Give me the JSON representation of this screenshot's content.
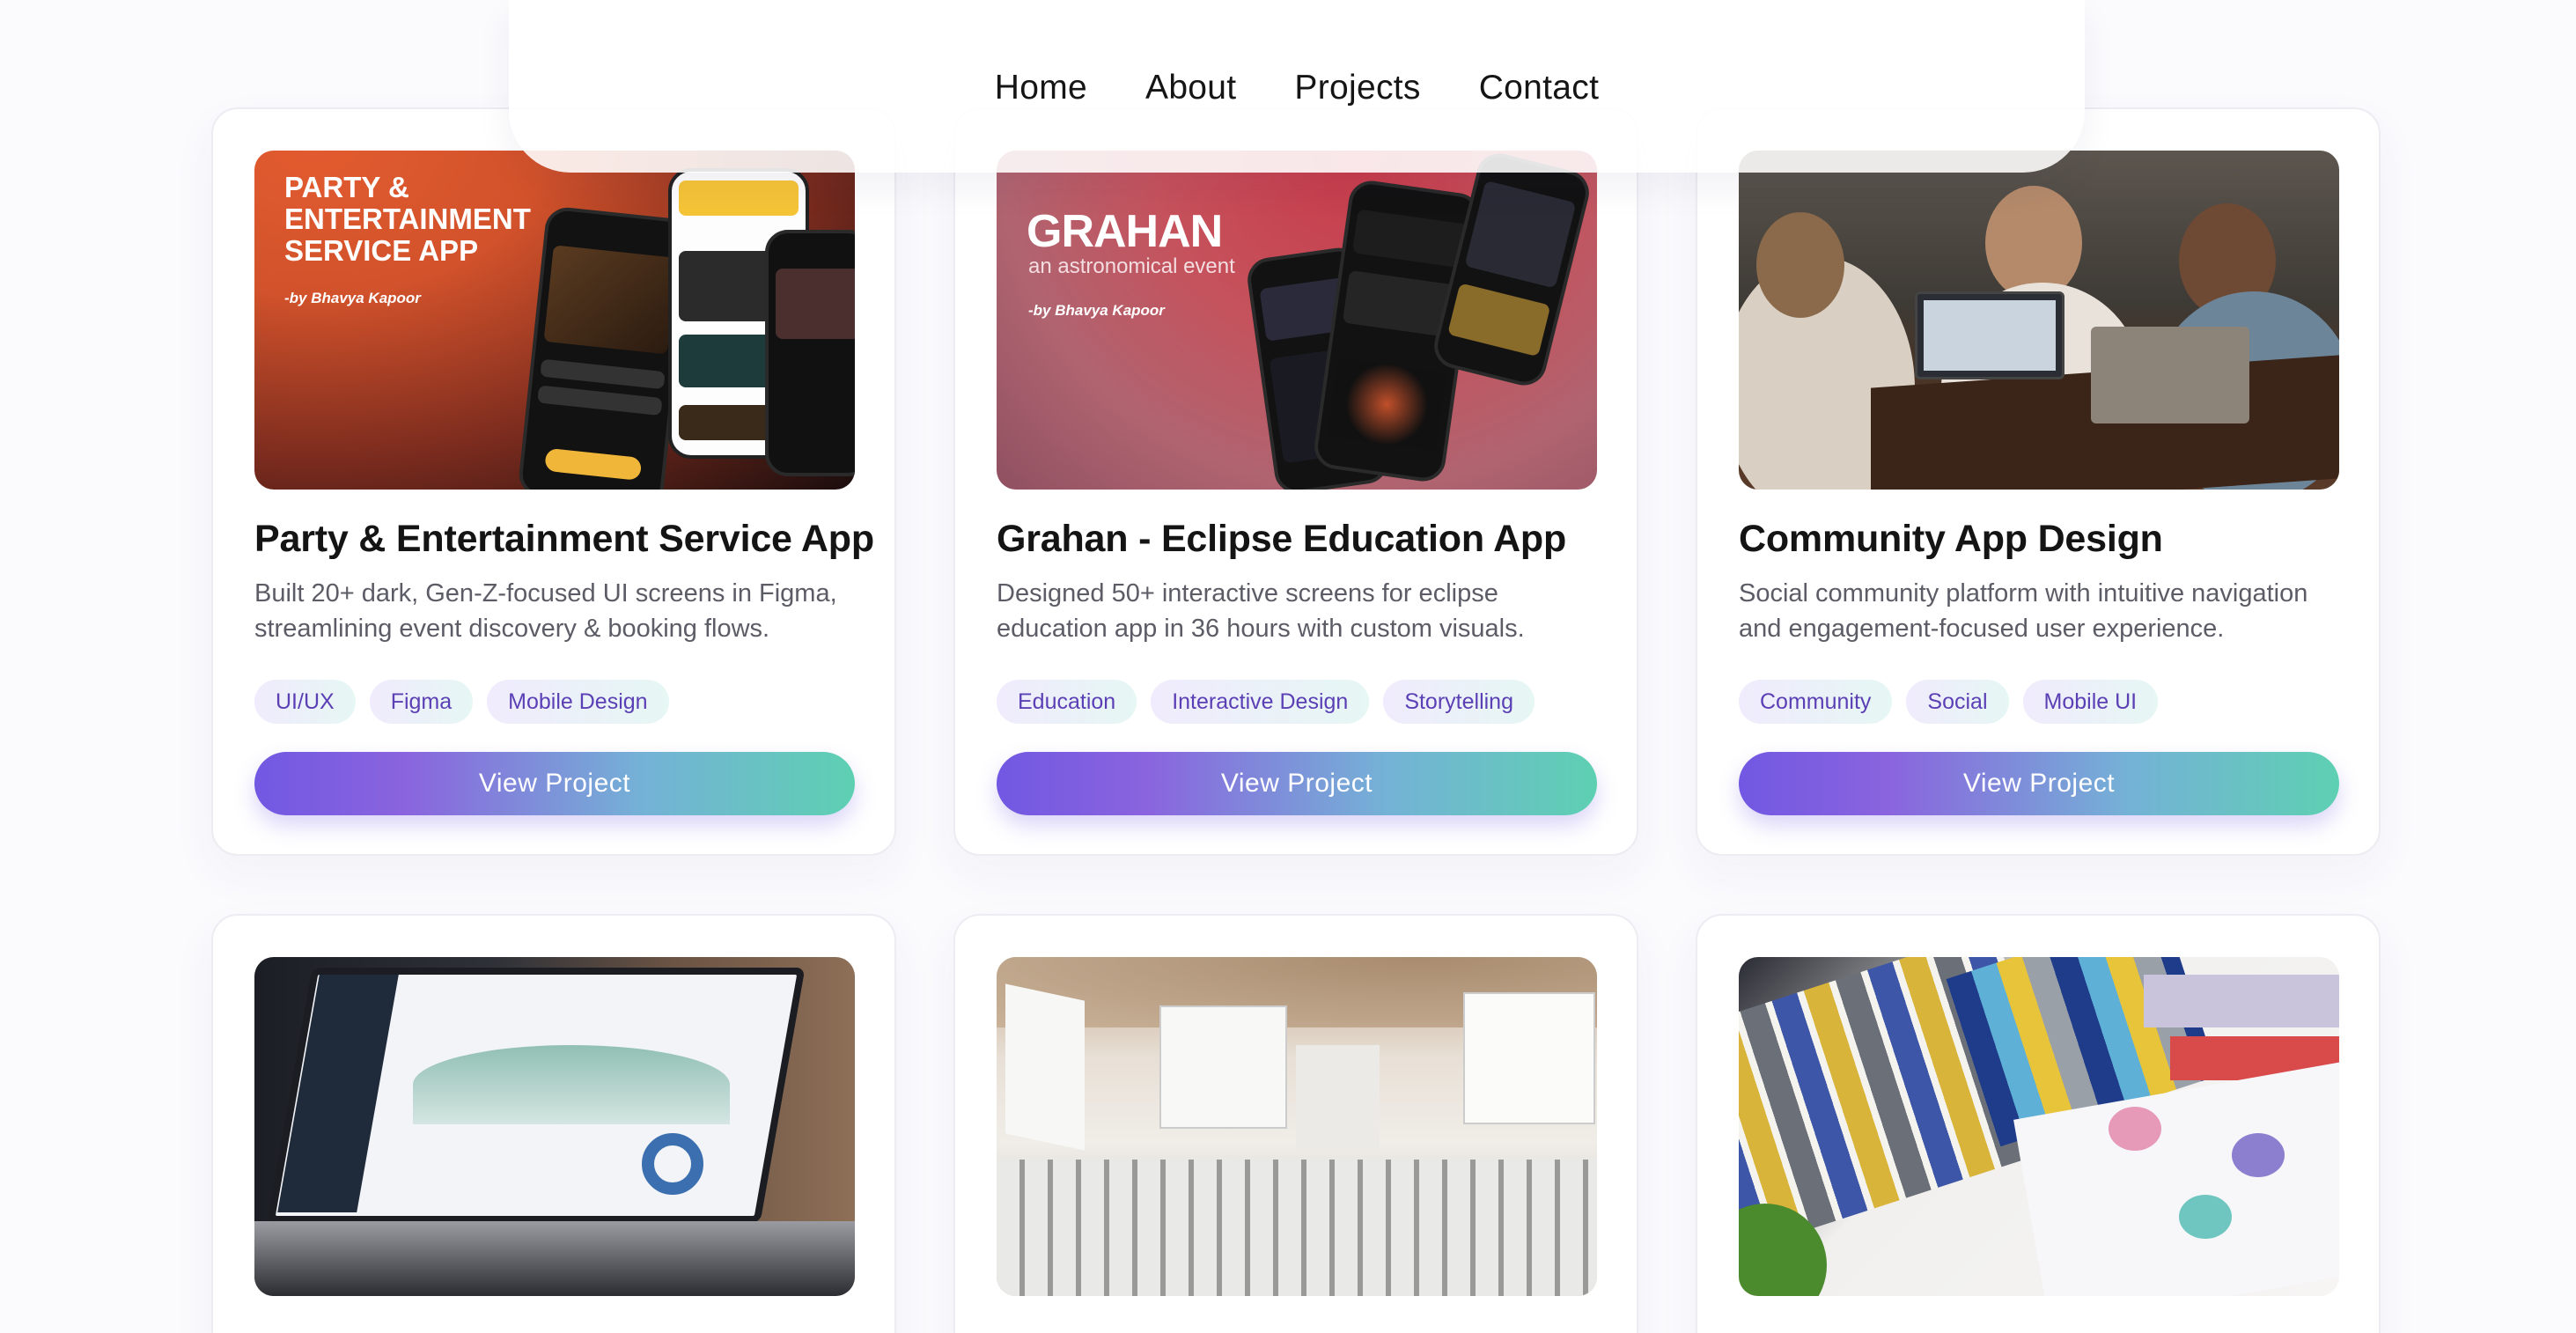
{
  "nav": {
    "items": [
      {
        "label": "Home"
      },
      {
        "label": "About"
      },
      {
        "label": "Projects"
      },
      {
        "label": "Contact"
      }
    ]
  },
  "projects": [
    {
      "title": "Party & Entertainment Service App",
      "description": "Built 20+ dark, Gen-Z-focused UI screens in Figma, streamlining event discovery & booking flows.",
      "tags": [
        "UI/UX",
        "Figma",
        "Mobile Design"
      ],
      "button_label": "View Project",
      "image": {
        "heading": "PARTY & ENTERTAINMENT SERVICE APP",
        "byline": "-by Bhavya Kapoor"
      }
    },
    {
      "title": "Grahan - Eclipse Education App",
      "description": "Designed 50+ interactive screens for eclipse education app in 36 hours with custom visuals.",
      "tags": [
        "Education",
        "Interactive Design",
        "Storytelling"
      ],
      "button_label": "View Project",
      "image": {
        "heading": "GRAHAN",
        "subheading": "an astronomical event",
        "byline": "-by Bhavya Kapoor"
      }
    },
    {
      "title": "Community App Design",
      "description": "Social community platform with intuitive navigation and engagement-focused user experience.",
      "tags": [
        "Community",
        "Social",
        "Mobile UI"
      ],
      "button_label": "View Project"
    }
  ],
  "colors": {
    "accent_start": "#7158e2",
    "accent_end": "#5ed0b2",
    "tag_text": "#5b3fb5"
  }
}
